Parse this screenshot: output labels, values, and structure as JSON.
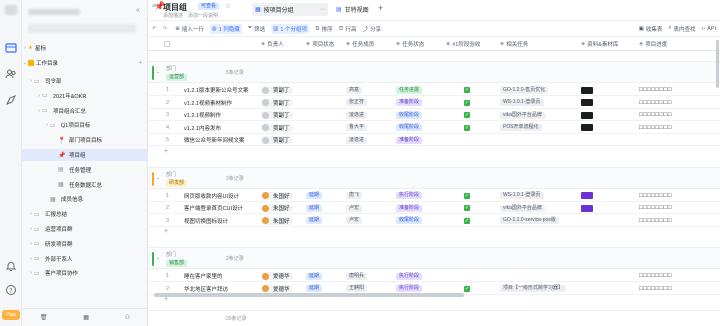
{
  "rail": {
    "badge": "Plus"
  },
  "sidebar": {
    "star_label": "星标",
    "workspace_label": "工作目录",
    "items": [
      {
        "label": "司令部",
        "depth": 1
      },
      {
        "label": "2021年&OKR",
        "depth": 2
      },
      {
        "label": "项目组合汇总",
        "depth": 2
      },
      {
        "label": "Q1项目目标",
        "depth": 3
      },
      {
        "label": "部门项目目标",
        "depth": 4
      },
      {
        "label": "项目组",
        "depth": 4
      },
      {
        "label": "任务管理",
        "depth": 4
      },
      {
        "label": "任务数据汇总",
        "depth": 4
      },
      {
        "label": "成员信息",
        "depth": 3
      },
      {
        "label": "汇报总结",
        "depth": 1
      },
      {
        "label": "运营项目群",
        "depth": 1
      },
      {
        "label": "研发项目群",
        "depth": 1
      },
      {
        "label": "外部干系人",
        "depth": 1
      },
      {
        "label": "客户项目协作",
        "depth": 1
      }
    ]
  },
  "header": {
    "title": "项目组",
    "badge": "可查看",
    "subtitle": "添加描述",
    "subtitle2": "添加一段说明",
    "views": [
      {
        "label": "按项目分组"
      },
      {
        "label": "甘特视图"
      }
    ],
    "toolbar": [
      {
        "label": "插入一行"
      },
      {
        "label": "1 列隐藏"
      },
      {
        "label": "筛选"
      },
      {
        "label": "1 个分组项"
      },
      {
        "label": "排序"
      },
      {
        "label": "行高"
      },
      {
        "label": "分享"
      }
    ],
    "right_tools": [
      {
        "label": "收集表"
      },
      {
        "label": "表内查找"
      },
      {
        "label": "API"
      }
    ]
  },
  "columns": [
    "负责人",
    "项目状态",
    "任务成员",
    "任务状态",
    "#1阶段验收",
    "相关任务",
    "资料&素材库",
    "项目进度"
  ],
  "groups": [
    {
      "label": "部门",
      "tag": "运营部",
      "count": "5条记录",
      "color": "#3bb34a",
      "rows": [
        {
          "n": "1",
          "name": "v1.2.1版本更新公众号文案",
          "owner": "贾副丁",
          "state": "",
          "member": "高富",
          "mstate": "任务进展",
          "mclass": "c-green",
          "check": true,
          "rel": "GO-1.2.0-售页优化",
          "thumb": "dark",
          "prog": "□□□□□□□□"
        },
        {
          "n": "2",
          "name": "v1.2.1视频素材制作",
          "owner": "贾副丁",
          "state": "",
          "member": "张正符",
          "mstate": "准备阶段",
          "mclass": "c-purple",
          "check": true,
          "rel": "WS-1.0.1-登录页",
          "thumb": "dark",
          "prog": "□□□□□□□□"
        },
        {
          "n": "3",
          "name": "v1.2.1视频制作",
          "owner": "贾副丁",
          "state": "",
          "member": "凌逸进",
          "mstate": "收尾阶段",
          "mclass": "c-blue",
          "check": true,
          "rel": "vika国外平台品牌",
          "thumb": "dark",
          "prog": "□□□□□□□□"
        },
        {
          "n": "4",
          "name": "v1.2.1内容发布",
          "owner": "贾副丁",
          "state": "",
          "member": "鲁大平",
          "mstate": "收尾阶段",
          "mclass": "c-blue",
          "check": true,
          "rel": "POS开单流程化",
          "thumb": "dark",
          "prog": "□□□□□□□□"
        },
        {
          "n": "5",
          "name": "微信公众号新年间候文案",
          "owner": "贾副丁",
          "state": "",
          "member": "凌逸进",
          "mstate": "准备阶段",
          "mclass": "c-purple",
          "check": false,
          "rel": "",
          "thumb": "",
          "prog": ""
        }
      ]
    },
    {
      "label": "部门",
      "tag": "研发部",
      "count": "3条记录",
      "color": "#f5a623",
      "rows": [
        {
          "n": "1",
          "name": "网页版收款内容UI设计",
          "owner": "朱国好",
          "state": "延期",
          "member": "唐飞",
          "mstate": "执行阶段",
          "mclass": "c-purple",
          "check": true,
          "rel": "WS-1.0.1-登录页",
          "thumb": "purple",
          "prog": "□□□□□□□□"
        },
        {
          "n": "2",
          "name": "客户端登录首页CUI设计",
          "owner": "朱国好",
          "state": "延期",
          "member": "卢宏",
          "mstate": "准备阶段",
          "mclass": "c-purple",
          "check": true,
          "rel": "vika国外平台品牌",
          "thumb": "purple",
          "prog": "□□□□□□□□"
        },
        {
          "n": "3",
          "name": "视图切换图标设计",
          "owner": "朱国好",
          "state": "延期",
          "member": "卢宏",
          "mstate": "收尾阶段",
          "mclass": "c-blue",
          "check": true,
          "rel": "GO-1.1.0-service-pos版",
          "thumb": "",
          "prog": "□□□□□□□□"
        }
      ]
    },
    {
      "label": "部门",
      "tag": "销售部",
      "count": "2条记录",
      "color": "#3bb34a",
      "rows": [
        {
          "n": "1",
          "name": "睡在客户家里的",
          "owner": "爱德华",
          "state": "延期",
          "member": "唐明兵",
          "mstate": "执行阶段",
          "mclass": "c-purple",
          "check": false,
          "rel": "",
          "thumb": "",
          "prog": "□□□□□□□□"
        },
        {
          "n": "2",
          "name": "华北地区客户拜访",
          "owner": "爱德华",
          "state": "延期",
          "member": "王麒阳",
          "mstate": "执行阶段",
          "mclass": "c-purple",
          "check": true,
          "rel": "项目【一级形式跨学习器】",
          "thumb": "",
          "prog": "□□□□□□□□"
        }
      ]
    }
  ],
  "footer": {
    "count": "20条记录"
  },
  "colors": {
    "accent": "#3370ff",
    "green": "#3bb34a",
    "purple": "#6a32d8"
  }
}
